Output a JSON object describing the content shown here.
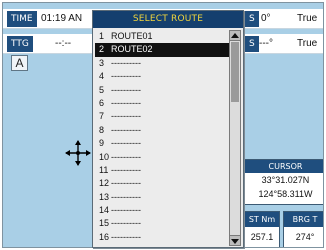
{
  "top_bar": {
    "time_label": "TIME",
    "time_value": "01:19 AN",
    "cog_value": "0°",
    "cog_ref": "True",
    "ttg_label": "TTG",
    "ttg_value": "--:--",
    "cts_value": "---°",
    "cts_ref": "True",
    "hidden_s_1": "S",
    "hidden_s_2": "S"
  },
  "range_box": "A",
  "dialog": {
    "title": "SELECT ROUTE",
    "routes": [
      {
        "num": "1",
        "name": "ROUTE01"
      },
      {
        "num": "2",
        "name": "ROUTE02"
      },
      {
        "num": "3",
        "name": "----------"
      },
      {
        "num": "4",
        "name": "----------"
      },
      {
        "num": "5",
        "name": "----------"
      },
      {
        "num": "6",
        "name": "----------"
      },
      {
        "num": "7",
        "name": "----------"
      },
      {
        "num": "8",
        "name": "----------"
      },
      {
        "num": "9",
        "name": "----------"
      },
      {
        "num": "10",
        "name": "----------"
      },
      {
        "num": "11",
        "name": "----------"
      },
      {
        "num": "12",
        "name": "----------"
      },
      {
        "num": "13",
        "name": "----------"
      },
      {
        "num": "14",
        "name": "----------"
      },
      {
        "num": "15",
        "name": "----------"
      },
      {
        "num": "16",
        "name": "----------"
      }
    ],
    "selected_index": 1
  },
  "cursor_panel": {
    "title": "CURSOR",
    "lat": "33°31.027N",
    "lon": "124°58.311W"
  },
  "dist_box": {
    "label": "ST Nm",
    "value": "257.1"
  },
  "brg_box": {
    "label": "BRG T",
    "value": "274°"
  }
}
